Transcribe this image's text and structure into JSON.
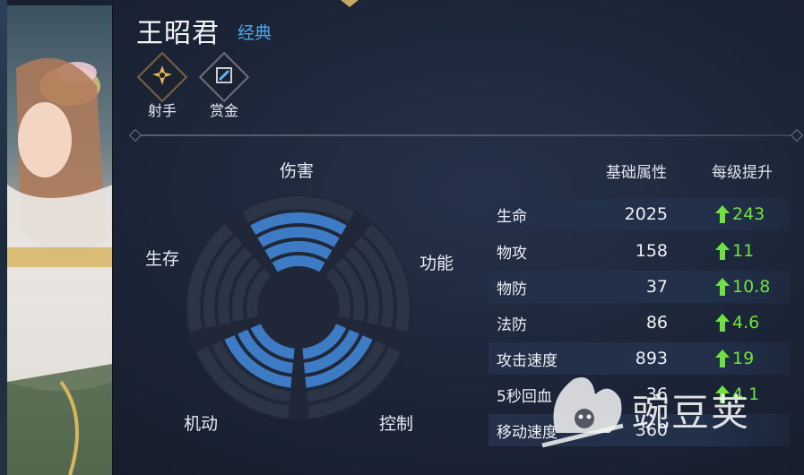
{
  "hero": {
    "name": "王昭君",
    "skin": "经典"
  },
  "roles": [
    {
      "label": "射手",
      "icon": "marksman-icon"
    },
    {
      "label": "赏金",
      "icon": "bounty-icon"
    }
  ],
  "radar": {
    "axes": [
      "伤害",
      "功能",
      "控制",
      "机动",
      "生存"
    ],
    "levels_of_5": {
      "伤害": 4,
      "功能": 0,
      "控制": 3,
      "机动": 3,
      "生存": 0
    },
    "fill_color": "#3d7cc4",
    "empty_color": "#2c3447"
  },
  "stats": {
    "header_base": "基础属性",
    "header_growth": "每级提升",
    "rows": [
      {
        "name": "生命",
        "base": "2025",
        "growth": "243"
      },
      {
        "name": "物攻",
        "base": "158",
        "growth": "11"
      },
      {
        "name": "物防",
        "base": "37",
        "growth": "10.8"
      },
      {
        "name": "法防",
        "base": "86",
        "growth": "4.6"
      },
      {
        "name": "攻击速度",
        "base": "893",
        "growth": "19"
      },
      {
        "name": "5秒回血",
        "base": "36",
        "growth": "4.1"
      },
      {
        "name": "移动速度",
        "base": "360",
        "growth": ""
      }
    ],
    "growth_color": "#6ee23e"
  },
  "watermark": {
    "text": "豌豆荚"
  }
}
